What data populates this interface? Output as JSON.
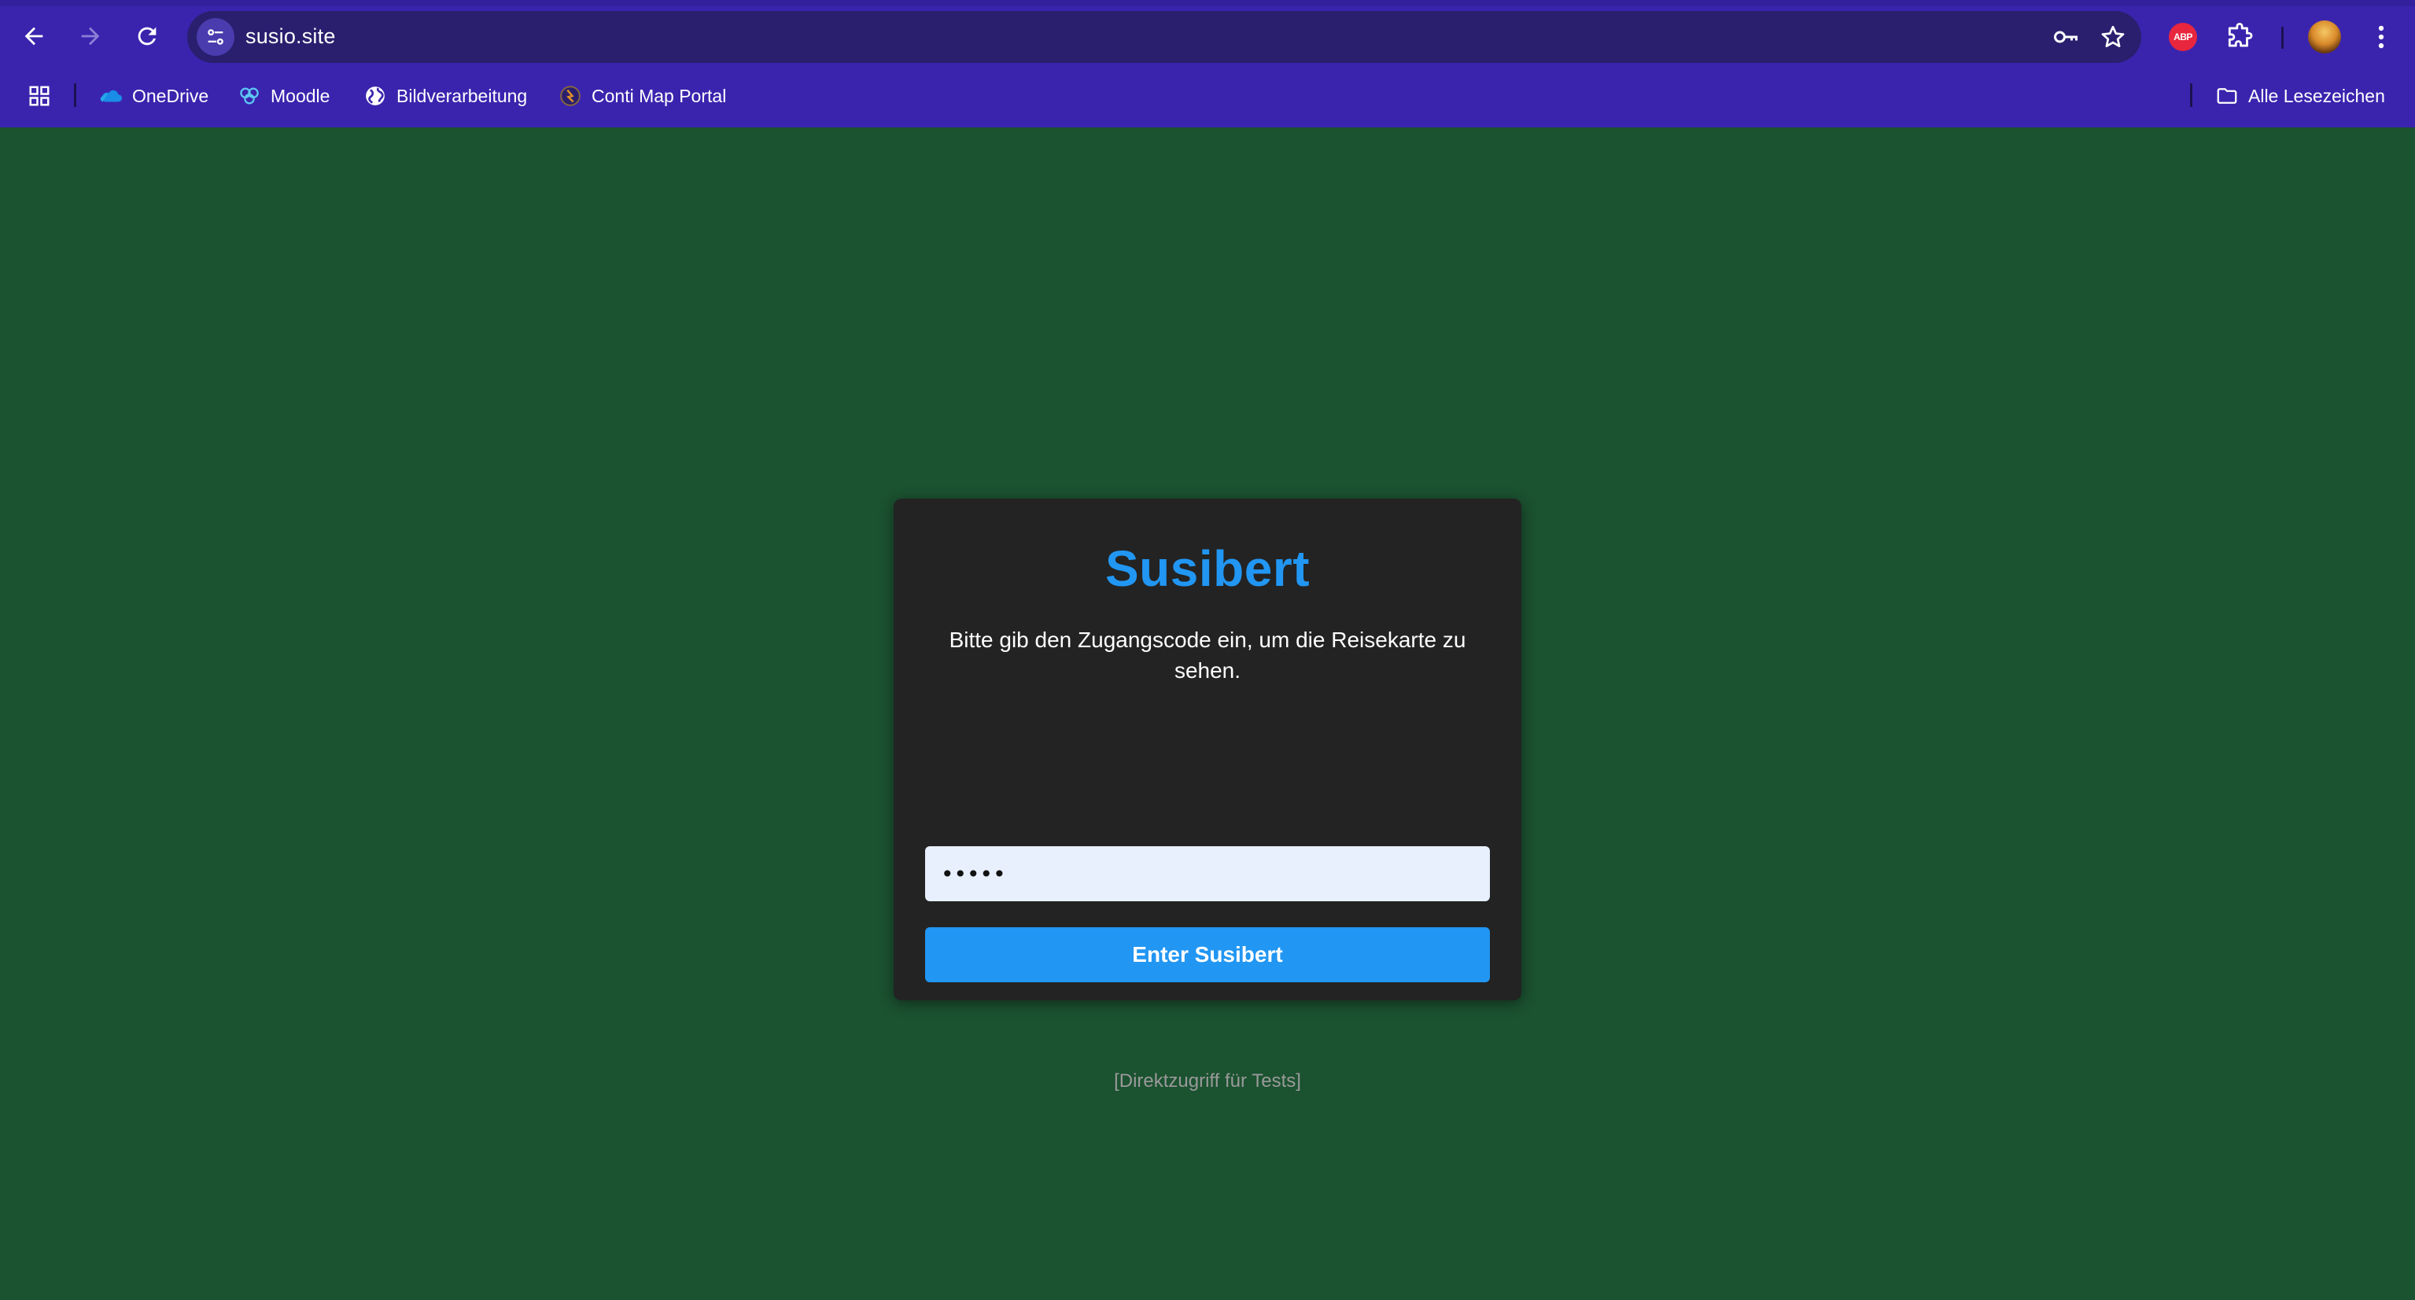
{
  "browser": {
    "url": "susio.site",
    "bookmarks": [
      {
        "label": "OneDrive",
        "icon": "onedrive-icon"
      },
      {
        "label": "Moodle",
        "icon": "moodle-icon"
      },
      {
        "label": "Bildverarbeitung",
        "icon": "globe-icon"
      },
      {
        "label": "Conti Map Portal",
        "icon": "conti-icon"
      }
    ],
    "all_bookmarks_label": "Alle Lesezeichen",
    "extension_abp_label": "ABP",
    "colors": {
      "chrome_bg": "#3a24ae",
      "omnibox_bg": "#2a1f6e",
      "page_bg": "#1b5230"
    }
  },
  "login": {
    "title": "Susibert",
    "description": "Bitte gib den Zugangscode ein, um die Reisekarte zu sehen.",
    "code_value": "•••••",
    "submit_label": "Enter Susibert",
    "direct_access_label": "[Direktzugriff für Tests]",
    "colors": {
      "card_bg": "#232323",
      "accent": "#2196f3",
      "input_bg": "#e8effd"
    }
  }
}
